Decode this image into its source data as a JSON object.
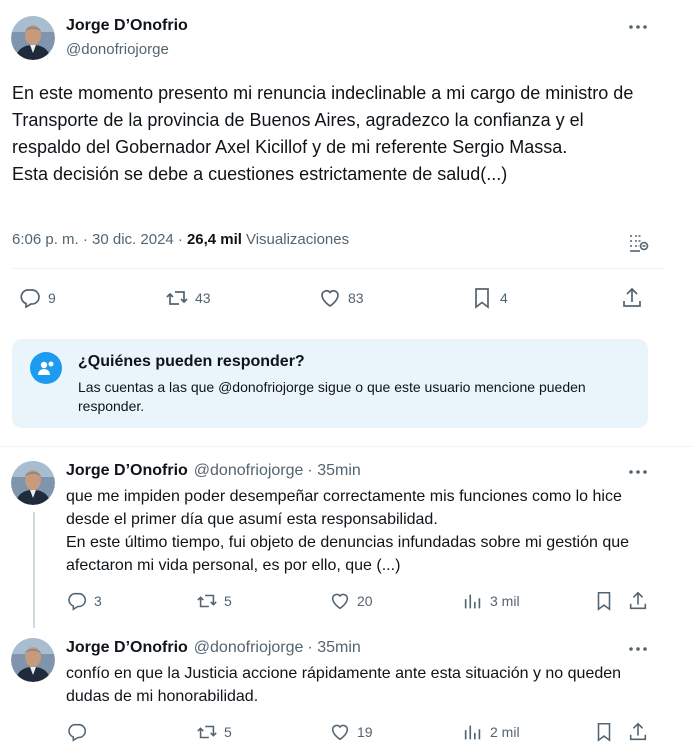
{
  "colors": {
    "accent": "#1d9bf0",
    "muted": "#536471",
    "text": "#0f1419",
    "reply_box_bg": "#eaf4fb"
  },
  "main_tweet": {
    "author_name": "Jorge D’Onofrio",
    "handle": "@donofriojorge",
    "text": "En este momento presento mi renuncia indeclinable a mi cargo de ministro de Transporte de la provincia de Buenos Aires, agradezco la confianza y el respaldo del Gobernador Axel Kicillof y de mi referente Sergio Massa.\nEsta decisión se debe a cuestiones estrictamente de salud(...)",
    "timestamp": "6:06 p. m. · 30 dic. 2024 ·",
    "views_count": "26,4 mil",
    "views_label": "Visualizaciones",
    "actions": {
      "replies": "9",
      "reposts": "43",
      "likes": "83",
      "bookmarks": "4"
    },
    "icons": [
      "more-icon",
      "analytics-icon",
      "reply-icon",
      "repost-icon",
      "like-icon",
      "bookmark-icon",
      "share-icon"
    ]
  },
  "reply_restriction": {
    "title": "¿Quiénes pueden responder?",
    "text": "Las cuentas a las que @donofriojorge sigue o que este usuario mencione pueden responder."
  },
  "replies": [
    {
      "author_name": "Jorge D’Onofrio",
      "handle": "@donofriojorge",
      "time": "· 35min",
      "text": "que me impiden poder desempeñar correctamente mis funciones como lo hice desde el primer día que asumí esta responsabilidad.\nEn este último tiempo, fui objeto de denuncias infundadas sobre mi gestión que afectaron mi vida personal, es por ello, que (...)",
      "replies": "3",
      "reposts": "5",
      "likes": "20",
      "views": "3 mil"
    },
    {
      "author_name": "Jorge D’Onofrio",
      "handle": "@donofriojorge",
      "time": "· 35min",
      "text": "confío en que la Justicia accione rápidamente ante esta situación y no queden dudas de mi honorabilidad.",
      "replies": "",
      "reposts": "5",
      "likes": "19",
      "views": "2 mil"
    }
  ]
}
